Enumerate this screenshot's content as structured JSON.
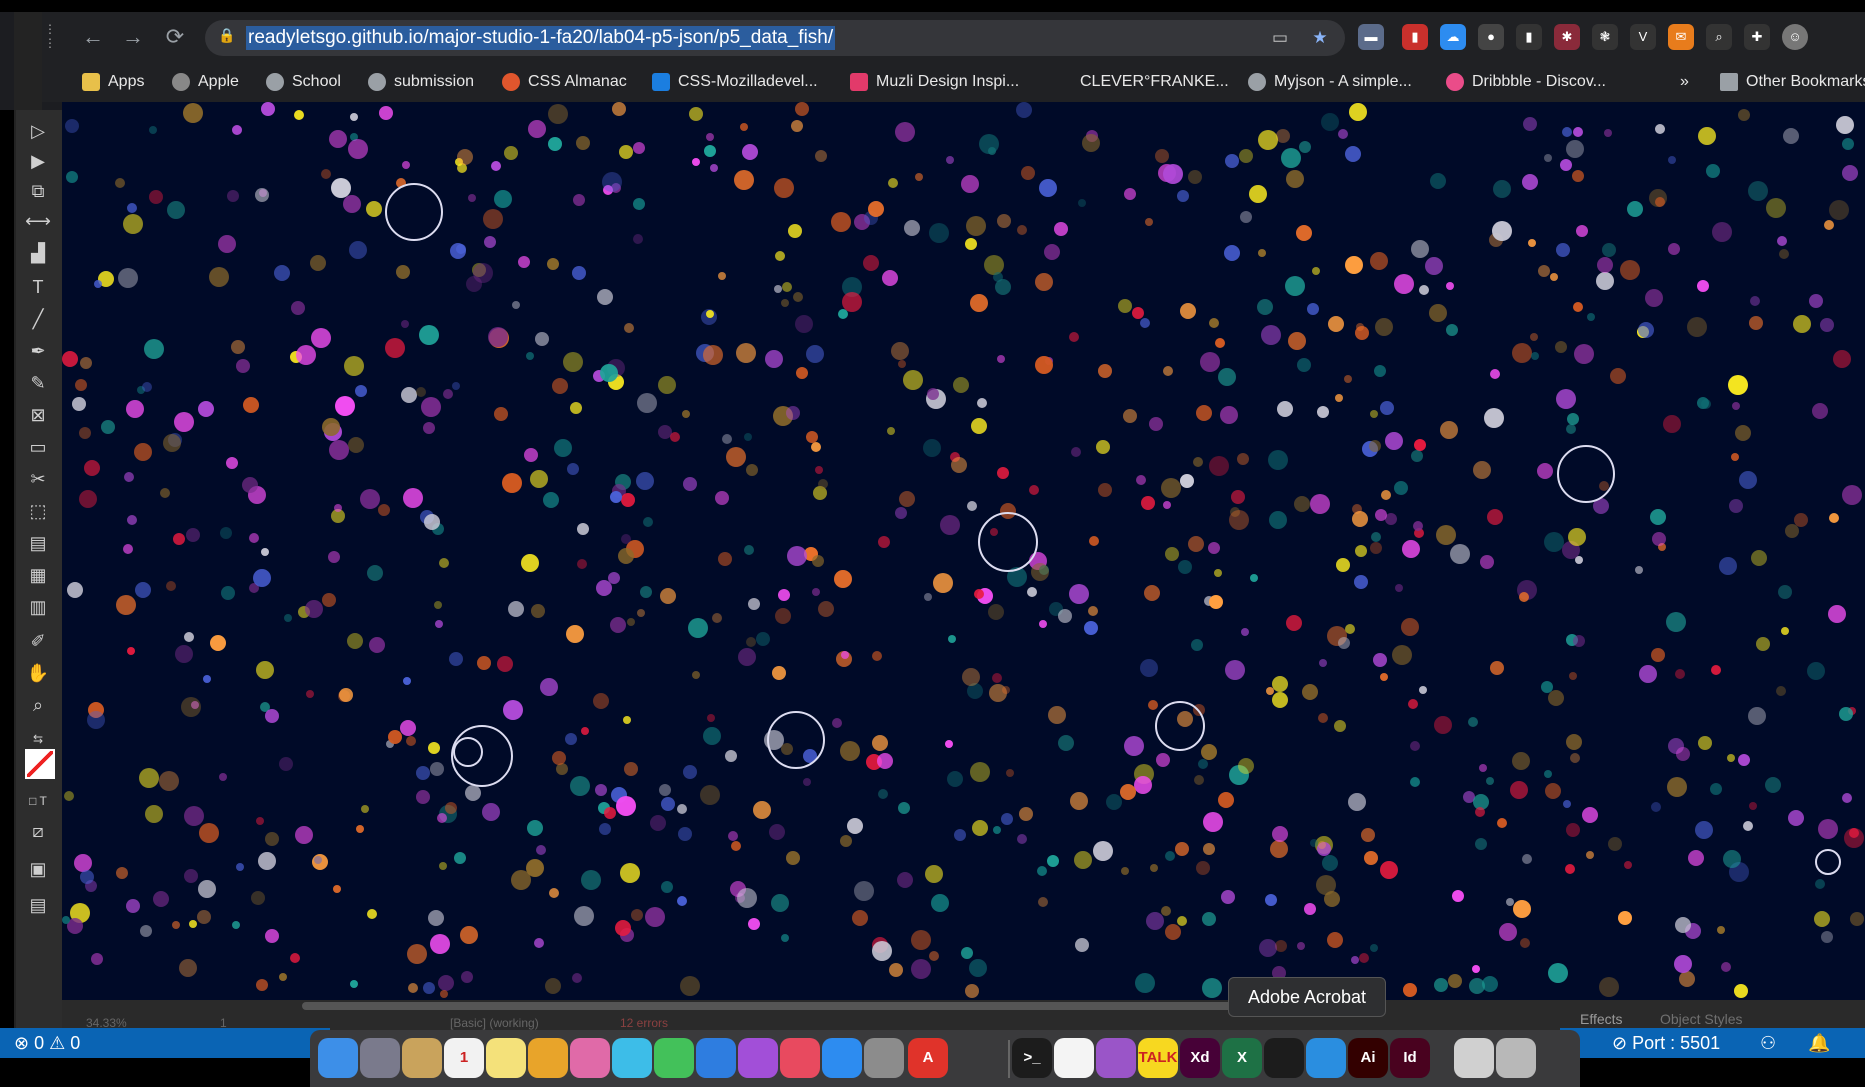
{
  "browser": {
    "url": "readyletsgo.github.io/major-studio-1-fa20/lab04-p5-json/p5_data_fish/",
    "nav_icons": [
      "back-arrow-icon",
      "forward-arrow-icon",
      "reload-icon"
    ],
    "bookmarks": [
      {
        "label": "Apps",
        "icon": "apps-grid-icon",
        "color": "#e8c04a"
      },
      {
        "label": "Apple",
        "icon": "apple-icon",
        "color": "#888888"
      },
      {
        "label": "School",
        "icon": "globe-icon",
        "color": "#9aa0a6"
      },
      {
        "label": "submission",
        "icon": "globe-icon",
        "color": "#9aa0a6"
      },
      {
        "label": "CSS Almanac",
        "icon": "almanac-icon",
        "color": "#e0562d"
      },
      {
        "label": "CSS-Mozilladevel...",
        "icon": "mdn-icon",
        "color": "#1b7ee0"
      },
      {
        "label": "Muzli Design Inspi...",
        "icon": "muzli-icon",
        "color": "#e23a6a"
      },
      {
        "label": "CLEVER°FRANKE...",
        "icon": "",
        "color": ""
      },
      {
        "label": "Myjson - A simple...",
        "icon": "globe-icon",
        "color": "#9aa0a6"
      },
      {
        "label": "Dribbble - Discov...",
        "icon": "dribbble-icon",
        "color": "#ea4c89"
      },
      {
        "label": "»",
        "icon": "",
        "color": ""
      },
      {
        "label": "Other Bookmarks",
        "icon": "folder-icon",
        "color": "#9aa0a6"
      }
    ]
  },
  "tooltip": "Adobe Acrobat",
  "illustrator": {
    "zoom": "34.33%",
    "artboard": "1",
    "profile": "[Basic] (working)",
    "errors": "12 errors",
    "panels": [
      "Effects",
      "Object Styles"
    ]
  },
  "vscode": {
    "problems": "⊗ 0 ⚠ 0",
    "port": "⊘ Port : 5501"
  },
  "dock_apps": [
    {
      "name": "finder-icon",
      "label": "",
      "color": "#3d8fe8"
    },
    {
      "name": "launchpad-icon",
      "label": "",
      "color": "#7a7a8c"
    },
    {
      "name": "notes-folder-icon",
      "label": "",
      "color": "#c9a35c"
    },
    {
      "name": "calendar-icon",
      "label": "1",
      "color": "#f2f2f2"
    },
    {
      "name": "notes-icon",
      "label": "",
      "color": "#f4e17a"
    },
    {
      "name": "chrome-icon",
      "label": "",
      "color": "#e8a42a"
    },
    {
      "name": "photos-icon",
      "label": "",
      "color": "#e06aa8"
    },
    {
      "name": "messages-icon",
      "label": "",
      "color": "#3dbde8"
    },
    {
      "name": "facetime-icon",
      "label": "",
      "color": "#43c15a"
    },
    {
      "name": "keynote-icon",
      "label": "",
      "color": "#2e7de0"
    },
    {
      "name": "podcasts-icon",
      "label": "",
      "color": "#a24fd8"
    },
    {
      "name": "music-icon",
      "label": "",
      "color": "#e84a5f"
    },
    {
      "name": "app-store-icon",
      "label": "",
      "color": "#2d8cf0"
    },
    {
      "name": "system-preferences-icon",
      "label": "",
      "color": "#8c8c8c"
    },
    {
      "name": "acrobat-icon",
      "label": "A",
      "color": "#e0332a"
    },
    {
      "name": "terminal-icon",
      "label": ">_",
      "color": "#1c1c1c"
    },
    {
      "name": "slack-icon",
      "label": "",
      "color": "#f4f4f4"
    },
    {
      "name": "github-icon",
      "label": "",
      "color": "#9a55c8"
    },
    {
      "name": "kakaotalk-icon",
      "label": "TALK",
      "color": "#f7d820"
    },
    {
      "name": "adobe-xd-icon",
      "label": "Xd",
      "color": "#470137"
    },
    {
      "name": "excel-icon",
      "label": "X",
      "color": "#1e7145"
    },
    {
      "name": "acrobat-reader-icon",
      "label": "",
      "color": "#1c1c1c"
    },
    {
      "name": "vscode-icon",
      "label": "",
      "color": "#2a8ee0"
    },
    {
      "name": "illustrator-icon",
      "label": "Ai",
      "color": "#330000"
    },
    {
      "name": "indesign-icon",
      "label": "Id",
      "color": "#49021f"
    },
    {
      "name": "preview-icon",
      "label": "",
      "color": "#d0d0d0"
    },
    {
      "name": "trash-icon",
      "label": "",
      "color": "#b8b8b8"
    }
  ],
  "palette": [
    "#ff9f40",
    "#f04df0",
    "#e86f2a",
    "#d25a22",
    "#1fa59a",
    "#0f6e74",
    "#7a2c8e",
    "#4a62d9",
    "#8d6b2a",
    "#f6e720",
    "#e81b3f",
    "#c9c9d6",
    "#b04ad8"
  ]
}
